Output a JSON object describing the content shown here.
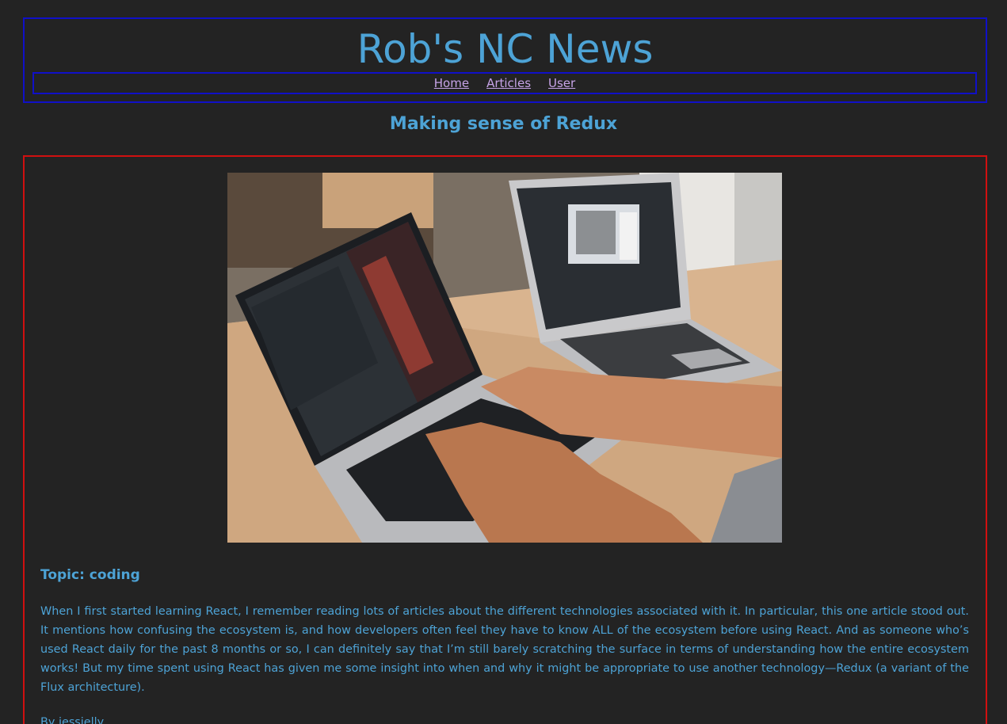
{
  "site": {
    "title": "Rob's NC News"
  },
  "nav": {
    "items": [
      {
        "label": "Home"
      },
      {
        "label": "Articles"
      },
      {
        "label": "User"
      }
    ]
  },
  "article": {
    "title": "Making sense of Redux",
    "topic": "Topic: coding",
    "body": "When I first started learning React, I remember reading lots of articles about the different technologies associated with it. In particular, this one article stood out. It mentions how confusing the ecosystem is, and how developers often feel they have to know ALL of the ecosystem before using React. And as someone who’s used React daily for the past 8 months or so, I can definitely say that I’m still barely scratching the surface in terms of understanding how the entire ecosystem works! But my time spent using React has given me some insight into when and why it might be appropriate to use another technology—Redux (a variant of the Flux architecture).",
    "author": "By jessjelly"
  },
  "colors": {
    "background": "#232323",
    "accent": "#4da3d6",
    "link": "#c6a3e6",
    "header_border": "#1010c8",
    "card_border": "#d01010"
  }
}
